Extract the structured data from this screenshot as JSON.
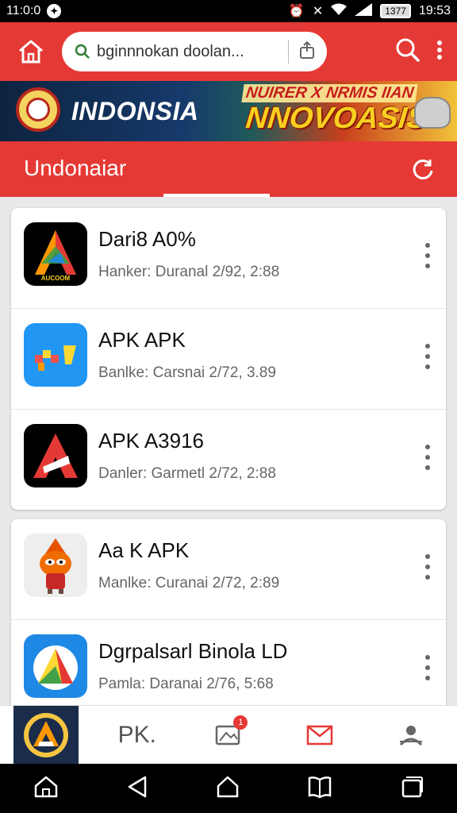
{
  "status_bar": {
    "time_left": "11:0:0",
    "time_right": "19:53",
    "battery": "1377"
  },
  "app_bar": {
    "search_text": "bginnnokan doolan...",
    "icons": [
      "home-icon",
      "search-icon",
      "share-icon",
      "magnifier-icon",
      "more-vert-icon"
    ]
  },
  "banner": {
    "title": "INDONSIA",
    "subtitle": "NUIRER X NRMIS IIAN",
    "headline": "NNOVOASIS"
  },
  "section": {
    "title": "Undonaiar"
  },
  "apps": [
    {
      "name": "Dari8 A0%",
      "meta": "Hanker: Duranal 2/92, 2:88",
      "icon_color": "#000000"
    },
    {
      "name": "APK APK",
      "meta": "Banlke: Carsnai 2/72, 3.89",
      "icon_color": "#2196f3"
    },
    {
      "name": "APK A3916",
      "meta": "Danler: Garmetl 2/72, 2:88",
      "icon_color": "#000000"
    },
    {
      "name": "Aa K APK",
      "meta": "Manlke: Curanai 2/72, 2:89",
      "icon_color": "#eeeeee"
    },
    {
      "name": "Dgrpalsarl Binola LD",
      "meta": "Pamla: Daranai 2/76, 5:68",
      "icon_color": "#1e88e5"
    }
  ],
  "bottom_tabs": {
    "pk_label": "PK.",
    "badge": "1"
  },
  "colors": {
    "accent": "#e53935"
  }
}
